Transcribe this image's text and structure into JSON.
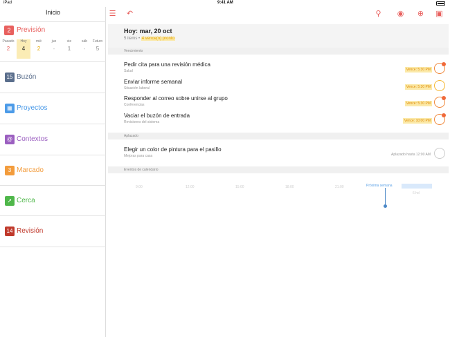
{
  "status_bar": {
    "carrier": "iPad",
    "time": "9:41 AM"
  },
  "sidebar": {
    "title": "Inicio",
    "forecast": {
      "badge": "2",
      "label": "Previsión",
      "color": "#e8605e",
      "days": [
        {
          "label": "Pasado",
          "value": "2",
          "color": "#e8605e"
        },
        {
          "label": "Hoy",
          "value": "4",
          "color": "#222222"
        },
        {
          "label": "mié",
          "value": "2",
          "color": "#e6a800"
        },
        {
          "label": "jue",
          "value": "-",
          "color": "#bbbbbb"
        },
        {
          "label": "vie",
          "value": "1",
          "color": "#888888"
        },
        {
          "label": "sáb",
          "value": "-",
          "color": "#bbbbbb"
        },
        {
          "label": "Futuro",
          "value": "5",
          "color": "#888888"
        }
      ]
    },
    "items": [
      {
        "badge": "15",
        "label": "Buzón",
        "color": "#5a6e8c",
        "text_color": "#5a6e8c"
      },
      {
        "badge": "",
        "label": "Proyectos",
        "color": "#4c9be8",
        "text_color": "#4c9be8",
        "icon": "projects-icon"
      },
      {
        "badge": "",
        "label": "Contextos",
        "color": "#9b5fc0",
        "text_color": "#9b5fc0",
        "icon": "at-sign-icon"
      },
      {
        "badge": "3",
        "label": "Marcado",
        "color": "#f39c3c",
        "text_color": "#f39c3c"
      },
      {
        "badge": "",
        "label": "Cerca",
        "color": "#4fb74a",
        "text_color": "#4fb74a",
        "icon": "location-arrow-icon"
      },
      {
        "badge": "14",
        "label": "Revisión",
        "color": "#c0392b",
        "text_color": "#c0392b"
      }
    ]
  },
  "toolbar": {
    "icons": [
      "list-icon",
      "undo-icon",
      "search-icon",
      "eye-icon",
      "add-icon",
      "inbox-icon"
    ],
    "accent": "#e8605e"
  },
  "header": {
    "title": "Hoy: mar, 20 oct",
    "subtitle": "5 items",
    "subtitle_sep": " • ",
    "warning": "4 vence(n) pronto"
  },
  "sections": {
    "due": "Vencimiento",
    "deferred": "Aplazado",
    "calendar": "Eventos de calendario"
  },
  "tasks_due": [
    {
      "title": "Pedir cita para una revisión médica",
      "context": "Salud",
      "due": "Vence: 5:30 PM",
      "check": "red"
    },
    {
      "title": "Enviar informe semanal",
      "context": "Situación laboral",
      "due": "Vence: 5:30 PM",
      "check": "yellow"
    },
    {
      "title": "Responder al correo sobre unirse al grupo",
      "context": "Conferencias",
      "due": "Vence: 5:30 PM",
      "check": "red"
    },
    {
      "title": "Vaciar el buzón de entrada",
      "context": "Revisiones del sistema",
      "due": "Vence: 10:00 PM",
      "check": "red"
    }
  ],
  "tasks_deferred": [
    {
      "title": "Elegir un color de pintura para el pasillo",
      "context": "Mejoras para casa",
      "due": "Aplazado hasta 12:00 AM",
      "check": "grey"
    }
  ],
  "calendar": {
    "labels": [
      "9:00",
      "12:00",
      "15:00",
      "18:00",
      "21:00"
    ],
    "week_label": "Próxima semana",
    "end_label": "6 hd"
  }
}
